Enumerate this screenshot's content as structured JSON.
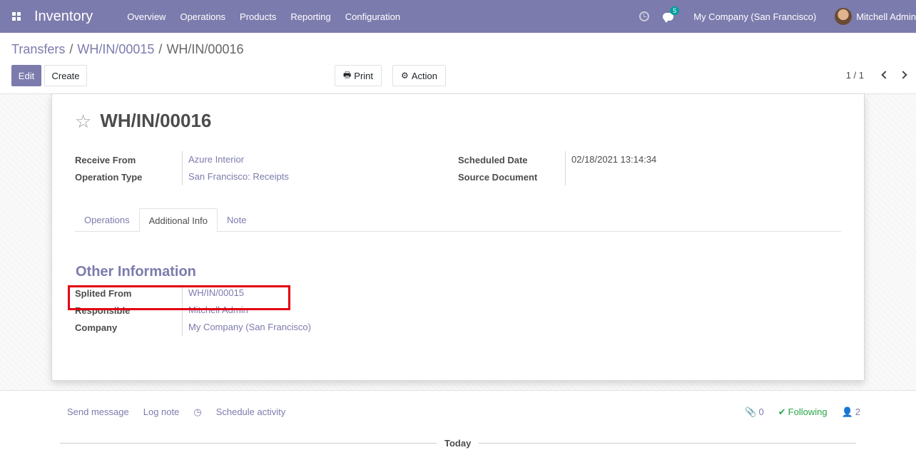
{
  "navbar": {
    "app_name": "Inventory",
    "menu": [
      "Overview",
      "Operations",
      "Products",
      "Reporting",
      "Configuration"
    ],
    "chat_count": "5",
    "company": "My Company (San Francisco)",
    "user": "Mitchell Admin",
    "color": "#7c7bad"
  },
  "breadcrumb": {
    "items": [
      "Transfers",
      "WH/IN/00015"
    ],
    "current": "WH/IN/00016",
    "separator": "/"
  },
  "buttons": {
    "edit": "Edit",
    "create": "Create",
    "print": "Print",
    "action": "Action"
  },
  "pager": {
    "text": "1 / 1"
  },
  "record": {
    "title": "WH/IN/00016",
    "left_fields": [
      {
        "label": "Receive From",
        "value": "Azure Interior"
      },
      {
        "label": "Operation Type",
        "value": "San Francisco: Receipts"
      }
    ],
    "right_fields": [
      {
        "label": "Scheduled Date",
        "value": "02/18/2021 13:14:34"
      },
      {
        "label": "Source Document",
        "value": ""
      }
    ]
  },
  "tabs": {
    "items": [
      "Operations",
      "Additional Info",
      "Note"
    ],
    "active": "Additional Info"
  },
  "other_info": {
    "title": "Other Information",
    "fields": [
      {
        "label": "Splited From",
        "value": "WH/IN/00015"
      },
      {
        "label": "Responsible",
        "value": "Mitchell Admin"
      },
      {
        "label": "Company",
        "value": "My Company (San Francisco)"
      }
    ],
    "highlight_color": "#e2000f"
  },
  "chatter": {
    "send_message": "Send message",
    "log_note": "Log note",
    "schedule_activity": "Schedule activity",
    "attachments": "0",
    "following": "Following",
    "followers": "2",
    "today": "Today"
  }
}
